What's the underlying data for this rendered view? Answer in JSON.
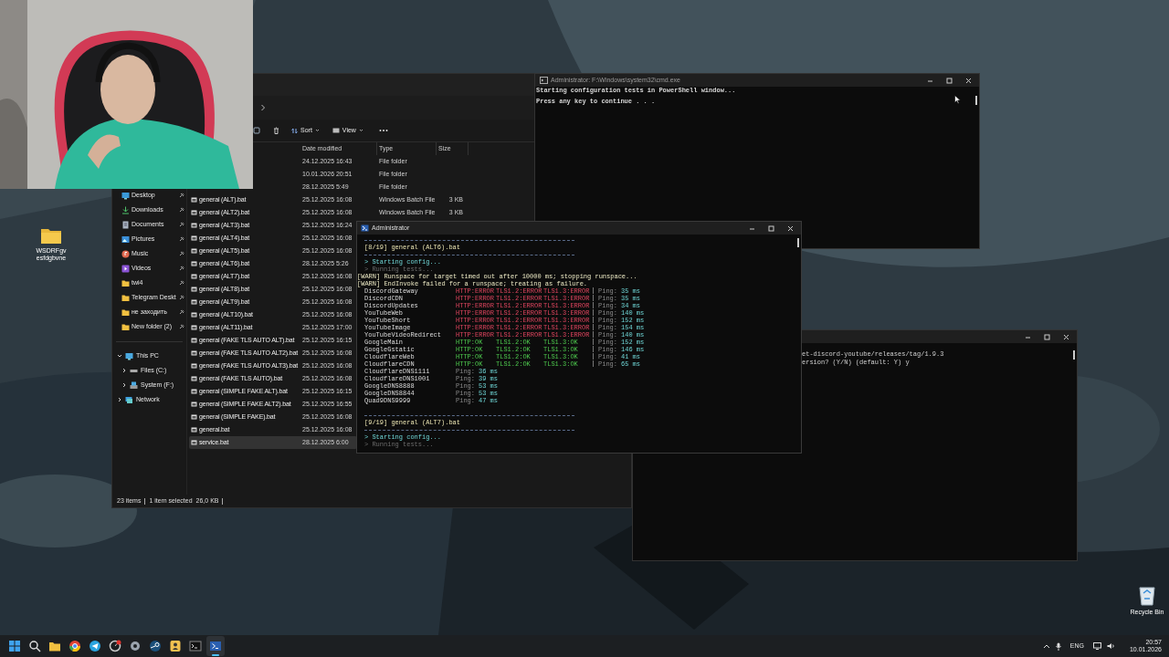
{
  "desktop_icons": [
    {
      "kind": "folder",
      "label": "WSDRFgv esfdgbvne"
    },
    {
      "kind": "recycle_bin",
      "label": "Recycle Bin"
    }
  ],
  "explorer": {
    "toolbar": {
      "sort": "Sort",
      "view": "View"
    },
    "columns": [
      "Date modified",
      "Type",
      "Size"
    ],
    "nav_items": [
      {
        "kind": "desktop",
        "label": "Desktop",
        "pinned": true
      },
      {
        "kind": "downloads",
        "label": "Downloads",
        "pinned": true
      },
      {
        "kind": "documents",
        "label": "Documents",
        "pinned": true
      },
      {
        "kind": "pictures",
        "label": "Pictures",
        "pinned": true
      },
      {
        "kind": "music",
        "label": "Music",
        "pinned": true
      },
      {
        "kind": "videos",
        "label": "Videos",
        "pinned": true
      },
      {
        "kind": "folder",
        "label": "twi4",
        "pinned": true
      },
      {
        "kind": "folder",
        "label": "Telegram Deskt",
        "pinned": true
      },
      {
        "kind": "folder",
        "label": "не заходить",
        "pinned": true
      },
      {
        "kind": "folder",
        "label": "New folder (2)",
        "pinned": true
      }
    ],
    "tree": [
      {
        "kind": "pc",
        "label": "This PC",
        "expanded": true,
        "children": [
          {
            "kind": "drive",
            "label": "Files (C:)",
            "expanded": false
          },
          {
            "kind": "system_drive",
            "label": "System (F:)",
            "expanded": false
          }
        ]
      },
      {
        "kind": "network",
        "label": "Network",
        "expanded": false
      }
    ],
    "files": [
      {
        "date": "24.12.2025 16:43",
        "type": "File folder",
        "selected": false
      },
      {
        "date": "10.01.2026 20:51",
        "type": "File folder",
        "selected": false
      },
      {
        "date": "28.12.2025 5:49",
        "type": "File folder",
        "selected": false
      },
      {
        "name": "general (ALT).bat",
        "date": "25.12.2025 16:08",
        "type": "Windows Batch File",
        "size": "3 KB",
        "selected": false
      },
      {
        "name": "general (ALT2).bat",
        "date": "25.12.2025 16:08",
        "type": "Windows Batch File",
        "size": "3 KB",
        "selected": false
      },
      {
        "name": "general (ALT3).bat",
        "date": "25.12.2025 16:24",
        "selected": false
      },
      {
        "name": "general (ALT4).bat",
        "date": "25.12.2025 16:08",
        "selected": false
      },
      {
        "name": "general (ALT5).bat",
        "date": "25.12.2025 16:08",
        "selected": false
      },
      {
        "name": "general (ALT6).bat",
        "date": "28.12.2025 5:26",
        "selected": false
      },
      {
        "name": "general (ALT7).bat",
        "date": "25.12.2025 16:08",
        "selected": false
      },
      {
        "name": "general (ALT8).bat",
        "date": "25.12.2025 16:08",
        "selected": false
      },
      {
        "name": "general (ALT9).bat",
        "date": "25.12.2025 16:08",
        "selected": false
      },
      {
        "name": "general (ALT10).bat",
        "date": "25.12.2025 16:08",
        "selected": false
      },
      {
        "name": "general (ALT11).bat",
        "date": "25.12.2025 17:00",
        "selected": false
      },
      {
        "name": "general (FAKE TLS AUTO ALT).bat",
        "date": "25.12.2025 16:15",
        "selected": false
      },
      {
        "name": "general (FAKE TLS AUTO ALT2).bat",
        "date": "25.12.2025 16:08",
        "selected": false
      },
      {
        "name": "general (FAKE TLS AUTO ALT3).bat",
        "date": "25.12.2025 16:08",
        "selected": false
      },
      {
        "name": "general (FAKE TLS AUTO).bat",
        "date": "25.12.2025 16:08",
        "selected": false
      },
      {
        "name": "general (SIMPLE FAKE ALT).bat",
        "date": "25.12.2025 16:15",
        "selected": false
      },
      {
        "name": "general (SIMPLE FAKE ALT2).bat",
        "date": "25.12.2025 16:55",
        "selected": false
      },
      {
        "name": "general (SIMPLE FAKE).bat",
        "date": "25.12.2025 16:08",
        "selected": false
      },
      {
        "name": "general.bat",
        "date": "25.12.2025 16:08",
        "selected": false
      },
      {
        "name": "service.bat",
        "date": "28.12.2025 6:00",
        "selected": true
      }
    ],
    "status_bar": {
      "count": "23 items",
      "selection": "1 item selected",
      "size": "26,0 KB"
    }
  },
  "cmd_window": {
    "title": "Administrator: F:\\Windows\\system32\\cmd.exe",
    "lines": [
      "Starting configuration tests in PowerShell window...",
      "Press any key to continue . . ."
    ]
  },
  "second_cmd_window": {
    "lines": [
      "et-discord-youtube/releases/tag/1.9.3",
      "ersion? (Y/N) (default: Y) y"
    ]
  },
  "powershell_window": {
    "title": "Administrator",
    "lines": [
      {
        "kind": "rule"
      },
      {
        "kind": "header",
        "text": "[8/19] general (ALT6).bat"
      },
      {
        "kind": "rule"
      },
      {
        "kind": "step",
        "text": "> Starting config..."
      },
      {
        "kind": "pending",
        "text": "> Running tests..."
      },
      {
        "kind": "warn",
        "text": "[WARN] Runspace for target timed out after 10000 ms; stopping runspace..."
      },
      {
        "kind": "warn",
        "text": "[WARN] EndInvoke failed for a runspace; treating as failure."
      },
      {
        "kind": "check",
        "target": "DiscordGateway",
        "http": "HTTP:ERROR",
        "tls12": "TLS1.2:ERROR",
        "tls13": "TLS1.3:ERROR",
        "ok": false,
        "ping_label": "Ping:",
        "ping": "35 ms"
      },
      {
        "kind": "check",
        "target": "DiscordCDN",
        "http": "HTTP:ERROR",
        "tls12": "TLS1.2:ERROR",
        "tls13": "TLS1.3:ERROR",
        "ok": false,
        "ping_label": "Ping:",
        "ping": "35 ms"
      },
      {
        "kind": "check",
        "target": "DiscordUpdates",
        "http": "HTTP:ERROR",
        "tls12": "TLS1.2:ERROR",
        "tls13": "TLS1.3:ERROR",
        "ok": false,
        "ping_label": "Ping:",
        "ping": "34 ms"
      },
      {
        "kind": "check",
        "target": "YouTubeWeb",
        "http": "HTTP:ERROR",
        "tls12": "TLS1.2:ERROR",
        "tls13": "TLS1.3:ERROR",
        "ok": false,
        "ping_label": "Ping:",
        "ping": "140 ms"
      },
      {
        "kind": "check",
        "target": "YouTubeShort",
        "http": "HTTP:ERROR",
        "tls12": "TLS1.2:ERROR",
        "tls13": "TLS1.3:ERROR",
        "ok": false,
        "ping_label": "Ping:",
        "ping": "152 ms"
      },
      {
        "kind": "check",
        "target": "YouTubeImage",
        "http": "HTTP:ERROR",
        "tls12": "TLS1.2:ERROR",
        "tls13": "TLS1.3:ERROR",
        "ok": false,
        "ping_label": "Ping:",
        "ping": "154 ms"
      },
      {
        "kind": "check",
        "target": "YouTubeVideoRedirect",
        "http": "HTTP:ERROR",
        "tls12": "TLS1.2:ERROR",
        "tls13": "TLS1.3:ERROR",
        "ok": false,
        "ping_label": "Ping:",
        "ping": "140 ms"
      },
      {
        "kind": "check",
        "target": "GoogleMain",
        "http": "HTTP:OK",
        "tls12": "TLS1.2:OK",
        "tls13": "TLS1.3:OK",
        "ok": true,
        "ping_label": "Ping:",
        "ping": "152 ms"
      },
      {
        "kind": "check",
        "target": "GoogleGstatic",
        "http": "HTTP:OK",
        "tls12": "TLS1.2:OK",
        "tls13": "TLS1.3:OK",
        "ok": true,
        "ping_label": "Ping:",
        "ping": "146 ms"
      },
      {
        "kind": "check",
        "target": "CloudflareWeb",
        "http": "HTTP:OK",
        "tls12": "TLS1.2:OK",
        "tls13": "TLS1.3:OK",
        "ok": true,
        "ping_label": "Ping:",
        "ping": "41 ms"
      },
      {
        "kind": "check",
        "target": "CloudflareCDN",
        "http": "HTTP:OK",
        "tls12": "TLS1.2:OK",
        "tls13": "TLS1.3:OK",
        "ok": true,
        "ping_label": "Ping:",
        "ping": "65 ms"
      },
      {
        "kind": "dns",
        "target": "CloudflareDNS1111",
        "ping_label": "Ping:",
        "ping": "36 ms"
      },
      {
        "kind": "dns",
        "target": "CloudflareDNS1001",
        "ping_label": "Ping:",
        "ping": "39 ms"
      },
      {
        "kind": "dns",
        "target": "GoogleDNS8888",
        "ping_label": "Ping:",
        "ping": "53 ms"
      },
      {
        "kind": "dns",
        "target": "GoogleDNS8844",
        "ping_label": "Ping:",
        "ping": "53 ms"
      },
      {
        "kind": "dns",
        "target": "Quad9DNS9999",
        "ping_label": "Ping:",
        "ping": "47 ms"
      },
      {
        "kind": "blank"
      },
      {
        "kind": "rule"
      },
      {
        "kind": "header",
        "text": "[9/19] general (ALT7).bat"
      },
      {
        "kind": "rule"
      },
      {
        "kind": "step",
        "text": "> Starting config..."
      },
      {
        "kind": "pending",
        "text": "> Running tests..."
      }
    ]
  },
  "taskbar": {
    "apps": [
      {
        "kind": "start",
        "selected": false
      },
      {
        "kind": "search",
        "selected": false
      },
      {
        "kind": "explorer",
        "selected": false
      },
      {
        "kind": "browser",
        "selected": false
      },
      {
        "kind": "messenger",
        "selected": false
      },
      {
        "kind": "badge_app",
        "selected": false
      },
      {
        "kind": "settings",
        "selected": false
      },
      {
        "kind": "steam",
        "selected": false
      },
      {
        "kind": "person_app",
        "selected": false
      },
      {
        "kind": "terminal",
        "selected": false
      },
      {
        "kind": "powershell",
        "selected": true
      }
    ],
    "language": "ENG",
    "time": "20:57",
    "date": "10.01.2026"
  }
}
